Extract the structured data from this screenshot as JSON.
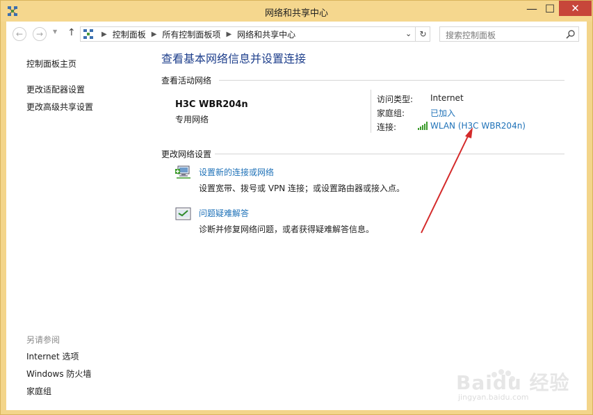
{
  "window": {
    "title": "网络和共享中心",
    "controls": {
      "minimize": "—",
      "maximize": "☐",
      "close": "✕"
    }
  },
  "address": {
    "breadcrumbs": [
      "控制面板",
      "所有控制面板项",
      "网络和共享中心"
    ],
    "search_placeholder": "搜索控制面板"
  },
  "sidebar": {
    "home": "控制面板主页",
    "links": [
      "更改适配器设置",
      "更改高级共享设置"
    ],
    "see_also_title": "另请参阅",
    "see_also": [
      "Internet 选项",
      "Windows 防火墙",
      "家庭组"
    ]
  },
  "main": {
    "heading": "查看基本网络信息并设置连接",
    "active_networks_title": "查看活动网络",
    "network": {
      "name": "H3C WBR204n",
      "category": "专用网络",
      "access_type_label": "访问类型:",
      "access_type_value": "Internet",
      "homegroup_label": "家庭组:",
      "homegroup_value": "已加入",
      "connection_label": "连接:",
      "connection_value": "WLAN (H3C WBR204n)"
    },
    "change_settings_title": "更改网络设置",
    "tasks": [
      {
        "link": "设置新的连接或网络",
        "desc": "设置宽带、拨号或 VPN 连接；或设置路由器或接入点。"
      },
      {
        "link": "问题疑难解答",
        "desc": "诊断并修复网络问题，或者获得疑难解答信息。"
      }
    ]
  },
  "watermark": {
    "text": "Baidu 经验",
    "url": "jingyan.baidu.com"
  },
  "colors": {
    "frame": "#f3d58a",
    "link": "#1f72b8",
    "heading": "#1e3f8c",
    "close": "#c7463a",
    "arrow": "#d42a2a"
  }
}
